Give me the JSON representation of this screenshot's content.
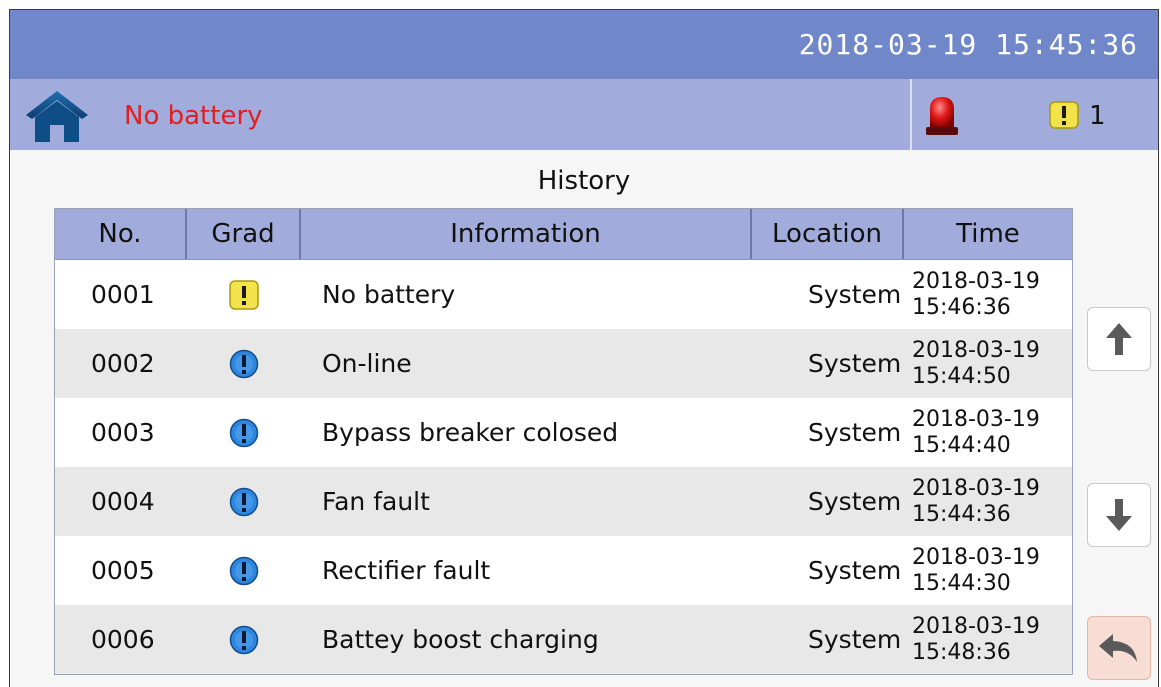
{
  "header": {
    "datetime": "2018-03-19  15:45:36"
  },
  "status": {
    "message": "No battery",
    "warning_count": "1",
    "home_icon": "home-icon",
    "alarm_icon": "alarm-light-icon",
    "warning_icon": "warning-icon"
  },
  "history": {
    "title": "History",
    "columns": [
      "No.",
      "Grad",
      "Information",
      "Location",
      "Time"
    ],
    "rows": [
      {
        "no": "0001",
        "grade": "warning",
        "info": "No battery",
        "location": "System",
        "date": "2018-03-19",
        "time": "15:46:36"
      },
      {
        "no": "0002",
        "grade": "info",
        "info": "On-line",
        "location": "System",
        "date": "2018-03-19",
        "time": "15:44:50"
      },
      {
        "no": "0003",
        "grade": "info",
        "info": "Bypass breaker colosed",
        "location": "System",
        "date": "2018-03-19",
        "time": "15:44:40"
      },
      {
        "no": "0004",
        "grade": "info",
        "info": "Fan fault",
        "location": "System",
        "date": "2018-03-19",
        "time": "15:44:36"
      },
      {
        "no": "0005",
        "grade": "info",
        "info": "Rectifier fault",
        "location": "System",
        "date": "2018-03-19",
        "time": "15:44:30"
      },
      {
        "no": "0006",
        "grade": "info",
        "info": "Battey boost charging",
        "location": "System",
        "date": "2018-03-19",
        "time": "15:48:36"
      }
    ]
  },
  "nav": {
    "up_icon": "arrow-up-icon",
    "down_icon": "arrow-down-icon",
    "back_icon": "back-arrow-icon"
  },
  "colors": {
    "topbar": "#7088c9",
    "statusbar": "#a2acdc",
    "status_message": "#e02020",
    "warning_yellow": "#f2e34a",
    "info_blue": "#2d86e0"
  }
}
